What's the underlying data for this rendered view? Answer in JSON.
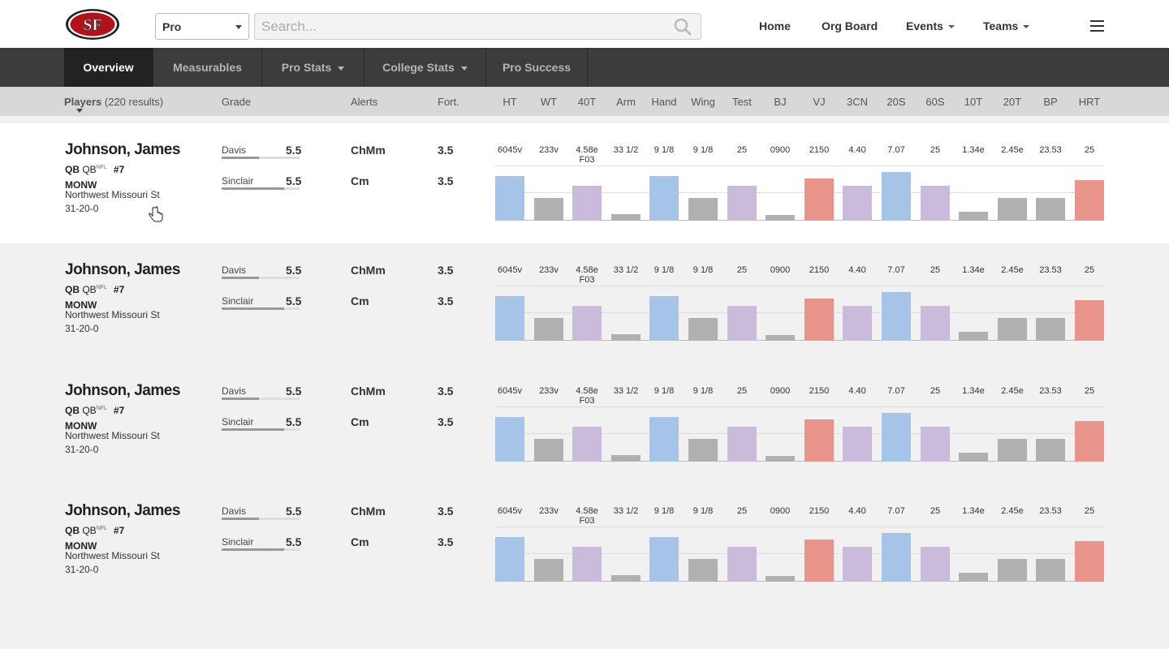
{
  "header": {
    "selector_value": "Pro",
    "search_placeholder": "Search...",
    "nav": [
      "Home",
      "Org Board",
      "Events",
      "Teams"
    ]
  },
  "tabs": [
    "Overview",
    "Measurables",
    "Pro Stats",
    "College Stats",
    "Pro Success"
  ],
  "columns": {
    "players": "Players",
    "results": "(220 results)",
    "grade": "Grade",
    "alerts": "Alerts",
    "fort": "Fort.",
    "measurables": [
      "HT",
      "WT",
      "40T",
      "Arm",
      "Hand",
      "Wing",
      "Test",
      "BJ",
      "VJ",
      "3CN",
      "20S",
      "60S",
      "10T",
      "20T",
      "BP",
      "HRT"
    ]
  },
  "colors": {
    "blue": "#a6c4e8",
    "gray": "#b0b0b0",
    "purple": "#c9bbd9",
    "red": "#e8948a",
    "tabbar": "#3c3c3c",
    "tab_active": "#222222"
  },
  "players": [
    {
      "name": "Johnson, James",
      "pos": "QB",
      "pos_nfl": "QB",
      "nfl_sup": "NFL",
      "jersey": "#7",
      "school_code": "MONW",
      "school": "Northwest Missouri St",
      "record": "31-20-0",
      "grades": [
        {
          "grader": "Davis",
          "value": "5.5",
          "level": 0.48
        },
        {
          "grader": "Sinclair",
          "value": "5.5",
          "level": 0.8
        }
      ],
      "alerts": [
        "ChMm",
        "Cm"
      ],
      "fort": [
        "3.5",
        "3.5"
      ],
      "measurables": [
        "6045v",
        "233v",
        "4.58e F03",
        "33 1/2",
        "9 1/8",
        "9 1/8",
        "25",
        "0900",
        "2150",
        "4.40",
        "7.07",
        "25",
        "1.34e",
        "2.45e",
        "23.53",
        "25"
      ]
    },
    {
      "name": "Johnson, James",
      "pos": "QB",
      "pos_nfl": "QB",
      "nfl_sup": "NFL",
      "jersey": "#7",
      "school_code": "MONW",
      "school": "Northwest Missouri St",
      "record": "31-20-0",
      "grades": [
        {
          "grader": "Davis",
          "value": "5.5",
          "level": 0.48
        },
        {
          "grader": "Sinclair",
          "value": "5.5",
          "level": 0.8
        }
      ],
      "alerts": [
        "ChMm",
        "Cm"
      ],
      "fort": [
        "3.5",
        "3.5"
      ],
      "measurables": [
        "6045v",
        "233v",
        "4.58e F03",
        "33 1/2",
        "9 1/8",
        "9 1/8",
        "25",
        "0900",
        "2150",
        "4.40",
        "7.07",
        "25",
        "1.34e",
        "2.45e",
        "23.53",
        "25"
      ]
    },
    {
      "name": "Johnson, James",
      "pos": "QB",
      "pos_nfl": "QB",
      "nfl_sup": "NFL",
      "jersey": "#7",
      "school_code": "MONW",
      "school": "Northwest Missouri St",
      "record": "31-20-0",
      "grades": [
        {
          "grader": "Davis",
          "value": "5.5",
          "level": 0.48
        },
        {
          "grader": "Sinclair",
          "value": "5.5",
          "level": 0.8
        }
      ],
      "alerts": [
        "ChMm",
        "Cm"
      ],
      "fort": [
        "3.5",
        "3.5"
      ],
      "measurables": [
        "6045v",
        "233v",
        "4.58e F03",
        "33 1/2",
        "9 1/8",
        "9 1/8",
        "25",
        "0900",
        "2150",
        "4.40",
        "7.07",
        "25",
        "1.34e",
        "2.45e",
        "23.53",
        "25"
      ]
    },
    {
      "name": "Johnson, James",
      "pos": "QB",
      "pos_nfl": "QB",
      "nfl_sup": "NFL",
      "jersey": "#7",
      "school_code": "MONW",
      "school": "Northwest Missouri St",
      "record": "31-20-0",
      "grades": [
        {
          "grader": "Davis",
          "value": "5.5",
          "level": 0.48
        },
        {
          "grader": "Sinclair",
          "value": "5.5",
          "level": 0.8
        }
      ],
      "alerts": [
        "ChMm",
        "Cm"
      ],
      "fort": [
        "3.5",
        "3.5"
      ],
      "measurables": [
        "6045v",
        "233v",
        "4.58e F03",
        "33 1/2",
        "9 1/8",
        "9 1/8",
        "25",
        "0900",
        "2150",
        "4.40",
        "7.07",
        "25",
        "1.34e",
        "2.45e",
        "23.53",
        "25"
      ]
    }
  ],
  "chart_data": {
    "type": "bar",
    "categories": [
      "HT",
      "WT",
      "40T",
      "Arm",
      "Hand",
      "Wing",
      "Test",
      "BJ",
      "VJ",
      "3CN",
      "20S",
      "60S",
      "10T",
      "20T",
      "BP",
      "HRT"
    ],
    "values": [
      0.91,
      0.46,
      0.72,
      0.13,
      0.91,
      0.46,
      0.72,
      0.12,
      0.87,
      0.72,
      1.0,
      0.72,
      0.18,
      0.46,
      0.46,
      0.84
    ],
    "bar_colors": [
      "blue",
      "gray",
      "purple",
      "gray",
      "blue",
      "gray",
      "purple",
      "gray",
      "red",
      "purple",
      "blue",
      "purple",
      "gray",
      "gray",
      "gray",
      "red"
    ],
    "ylim": [
      0,
      1
    ]
  }
}
